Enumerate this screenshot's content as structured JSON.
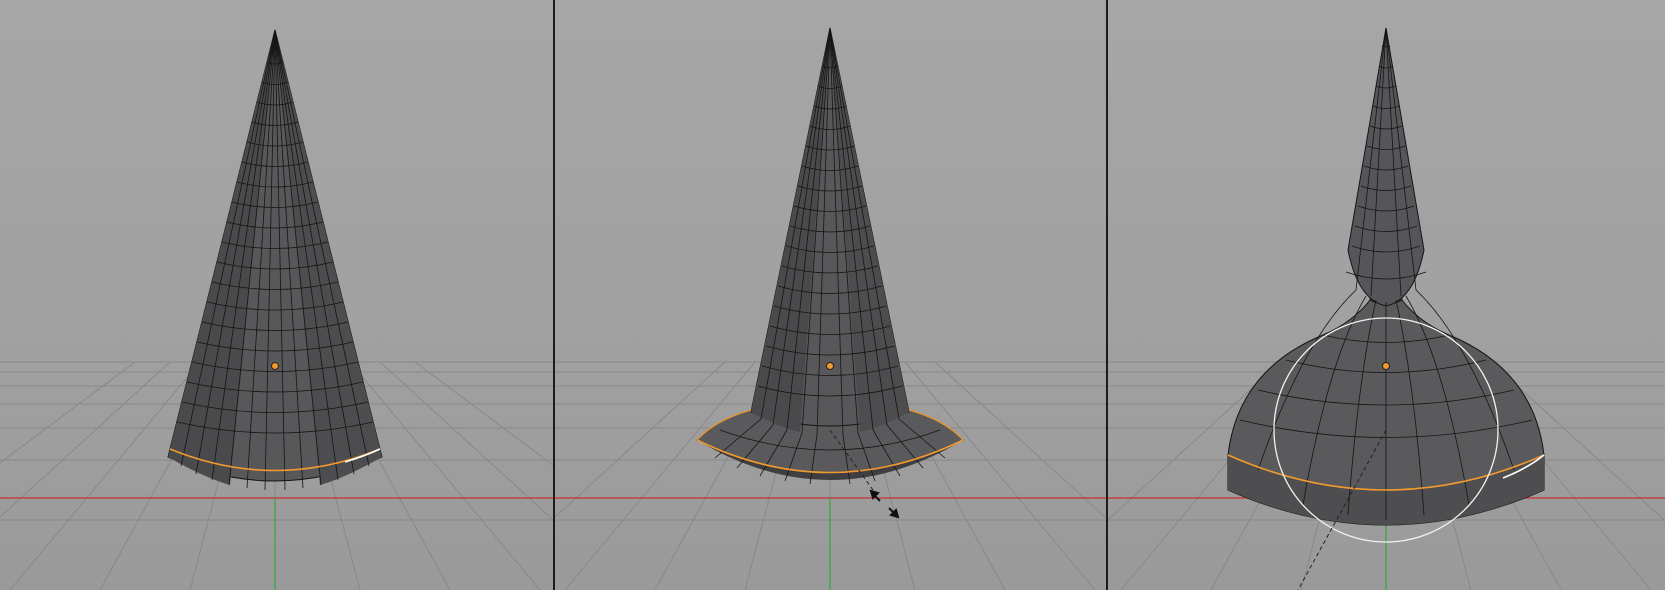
{
  "app": {
    "name": "3D viewport",
    "accent_color": "#f29a2e",
    "x_axis_color": "#c83030",
    "y_axis_color": "#2faa3c",
    "grid_color": "#8a8a8a",
    "background_color": "#a3a3a3",
    "mesh_color": "#555558",
    "wire_color": "#151515",
    "selection_color": "#f29a2e"
  },
  "viewports": [
    {
      "name": "cone-original",
      "object": "cone",
      "state": "base edge loop selected",
      "icons": [
        "origin-point-icon"
      ]
    },
    {
      "name": "cone-flared",
      "object": "cone",
      "state": "edge loop scaled outward",
      "icons": [
        "origin-point-icon",
        "scale-cursor-icon"
      ]
    },
    {
      "name": "cone-proportional",
      "object": "cone",
      "state": "proportional editing scale",
      "icons": [
        "origin-point-icon",
        "proportional-circle-icon"
      ]
    }
  ]
}
